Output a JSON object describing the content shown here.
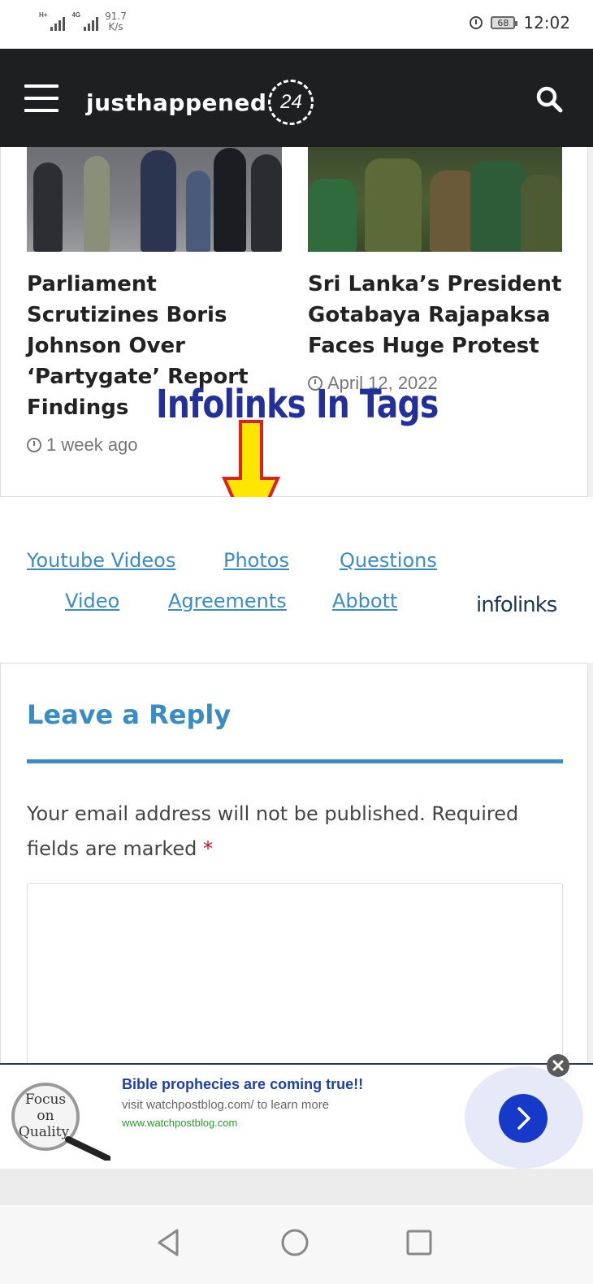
{
  "status_bar": {
    "signal1_tag": "H+",
    "signal2_tag": "4G",
    "net_speed_value": "91.7",
    "net_speed_unit": "K/s",
    "battery": "68",
    "time": "12:02"
  },
  "header": {
    "logo_text": "justhappened",
    "logo_badge": "24"
  },
  "articles": [
    {
      "title": "Parliament Scrutizines Boris Johnson Over ‘Partygate’ Report Findings",
      "meta": "1 week ago"
    },
    {
      "title": "Sri Lanka’s President Gotabaya Rajapaksa Faces Huge Protest",
      "meta": "April 12, 2022"
    }
  ],
  "annotation": {
    "text": "Infolinks In Tags",
    "color": "#23309a"
  },
  "tags": {
    "items": [
      "Youtube Videos",
      "Photos",
      "Questions",
      "Video",
      "Agreements",
      "Abbott"
    ],
    "brand": "infolinks",
    "link_color": "#3a8cc4"
  },
  "reply": {
    "title": "Leave a Reply",
    "note": "Your email address will not be published. Required fields are marked",
    "required_mark": "*"
  },
  "ad": {
    "image_text": "Focus on Quality",
    "headline": "Bible prophecies are coming true!!",
    "description": "visit watchpostblog.com/ to learn more",
    "url": "www.watchpostblog.com"
  },
  "colors": {
    "accent": "#3a8cc4",
    "header_bg": "#1e1f21",
    "ad_cta": "#1639c8"
  },
  "icons": [
    "menu-icon",
    "search-icon",
    "clock-icon",
    "arrow-down-icon",
    "chevron-right-icon",
    "close-icon",
    "back-icon",
    "home-icon",
    "recents-icon"
  ]
}
